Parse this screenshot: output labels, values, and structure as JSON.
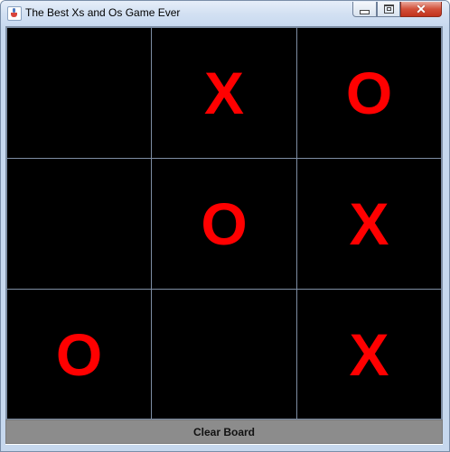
{
  "window": {
    "title": "The Best Xs and Os Game Ever",
    "controls": {
      "minimize": "minimize-icon",
      "maximize": "maximize-icon",
      "close_glyph": "✕"
    }
  },
  "board": {
    "rows": [
      [
        "",
        "X",
        "O"
      ],
      [
        "",
        "O",
        "X"
      ],
      [
        "O",
        "",
        "X"
      ]
    ],
    "mark_color": "#ff0000",
    "cell_background": "#000000",
    "grid_color": "#7e8ea4"
  },
  "footer": {
    "clear_label": "Clear Board"
  }
}
